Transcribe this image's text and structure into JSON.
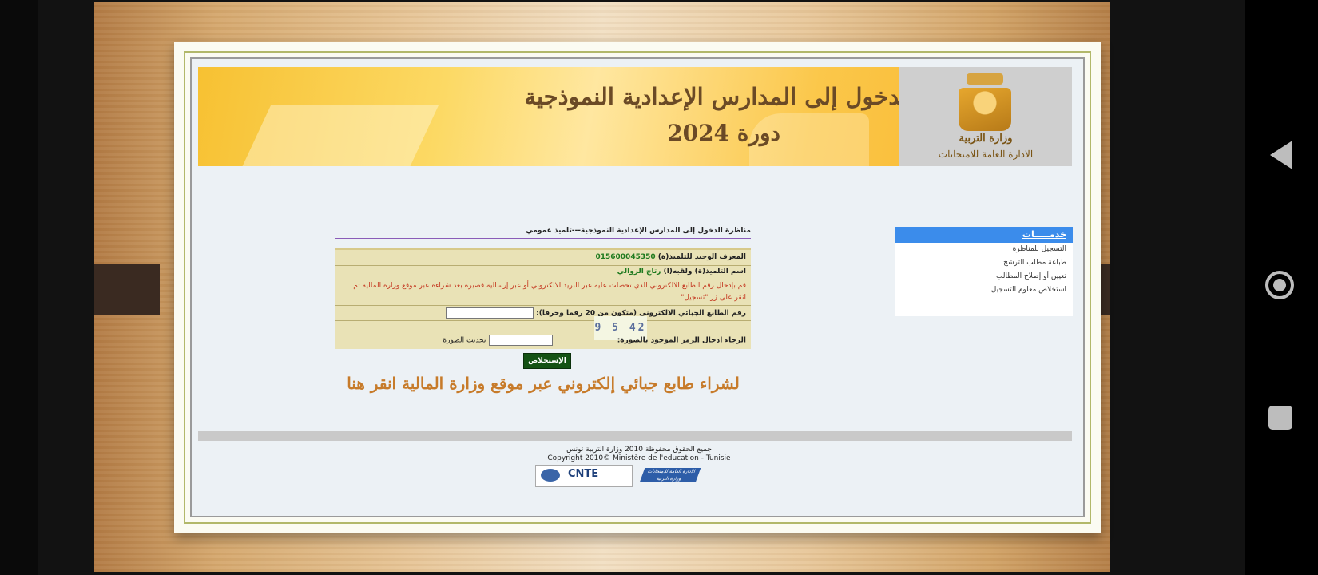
{
  "banner": {
    "title": "مناظرة الدخول إلى المدارس الإعدادية النموذجية",
    "session": "دورة 2024",
    "logo_ministry": "وزارة التربية",
    "logo_department": "الادارة العامة للامتحانات"
  },
  "services": {
    "header": "خدمـــــات",
    "links": [
      "التسجيل للمناظرة",
      "طباعة مطلب الترشح",
      "تعيين أو إصلاح المطالب",
      "استخلاص معلوم التسجيل"
    ]
  },
  "form": {
    "heading": "مناظرة الدخول إلى المدارس الإعدادية النموذجية---تلميذ عمومي",
    "id_label": "المعرف الوحيد للتلميذ(ة)",
    "id_value": "015600045350",
    "name_label": "اسم التلميذ(ة) ولقبه(ا)",
    "name_value": "رتاج الزوالي",
    "instructions": "قم بإدخال رقم الطابع الالكتروني الذي تحصلت عليه عبر البريد الالكتروني أو عبر إرسالية قصيرة بعد شراءه عبر موقع وزارة المالية ثم انقر على زر \"تسجيل\"",
    "stamp_label": "رقم الطابع الجبائي الالكتروني (متكون من 20 رقما وحرفا):",
    "stamp_value": "",
    "captcha_text": "42 5 9",
    "captcha_label": "الرجاء ادخال الرمز الموجود بالصورة:",
    "captcha_value": "",
    "refresh_label": "تحديث الصورة",
    "submit_label": "الإستخلاص"
  },
  "buy_link": "لشراء طابع جبائي إلكتروني عبر موقع وزارة المالية انقر هنا",
  "footer": {
    "rights_ar": "جميع الحقوق محفوظة 2010 وزارة التربية تونس",
    "rights_fr": "Copyright 2010© Ministère de l'education - Tunisie",
    "logo_cnte": "CNTE",
    "logo_dge": "الادارة العامة للامتحانات وزارة التربية"
  },
  "colors": {
    "services_header": "#3b8ceb",
    "submit_button": "#145214",
    "buy_link": "#c77b2a",
    "banner_text": "#6b4a26"
  }
}
